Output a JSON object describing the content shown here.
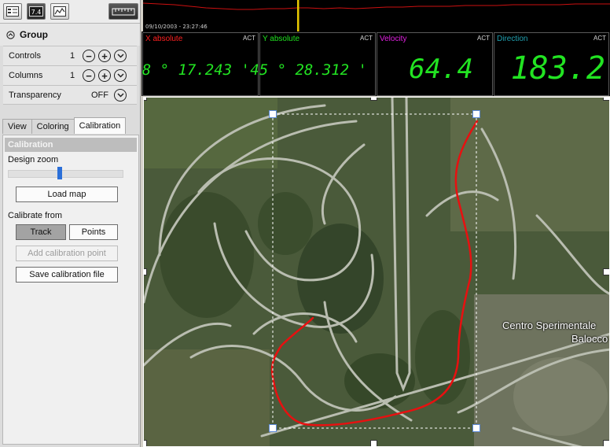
{
  "toolbar": {
    "icons": [
      "panel-icon",
      "numeric-display-icon",
      "graph-icon",
      "ruler-icon"
    ],
    "numeric_icon_text": "7.4"
  },
  "group": {
    "title": "Group",
    "rows": [
      {
        "label": "Controls",
        "value": "1"
      },
      {
        "label": "Columns",
        "value": "1"
      },
      {
        "label": "Transparency",
        "value": "OFF"
      }
    ]
  },
  "tabs": [
    {
      "label": "View",
      "active": false
    },
    {
      "label": "Coloring",
      "active": false
    },
    {
      "label": "Calibration",
      "active": true
    }
  ],
  "calibration": {
    "header": "Calibration",
    "design_zoom_label": "Design zoom",
    "design_zoom_fraction": 0.45,
    "load_map": "Load map",
    "calibrate_from": "Calibrate from",
    "track": "Track",
    "points": "Points",
    "add_point": "Add calibration point",
    "save_file": "Save calibration file"
  },
  "graph": {
    "timestamp": "09/10/2003 - 23:27:46",
    "cursor_color": "#e8c800",
    "trace_color": "#cc1010"
  },
  "readouts": [
    {
      "title": "X absolute",
      "title_color": "#ff2020",
      "act": "ACT",
      "value": "8 ° 17.243 '"
    },
    {
      "title": "Y absolute",
      "title_color": "#20e020",
      "act": "ACT",
      "value": "45 ° 28.312 '"
    },
    {
      "title": "Velocity",
      "title_color": "#e020e0",
      "act": "ACT",
      "value": "64.4"
    },
    {
      "title": "Direction",
      "title_color": "#20a0b0",
      "act": "ACT",
      "value": "183.2"
    }
  ],
  "map": {
    "place_line1": "Centro Sperimentale",
    "place_line2": "Balocco",
    "track_color": "#e81010",
    "readout_value_color": "#22e422"
  }
}
